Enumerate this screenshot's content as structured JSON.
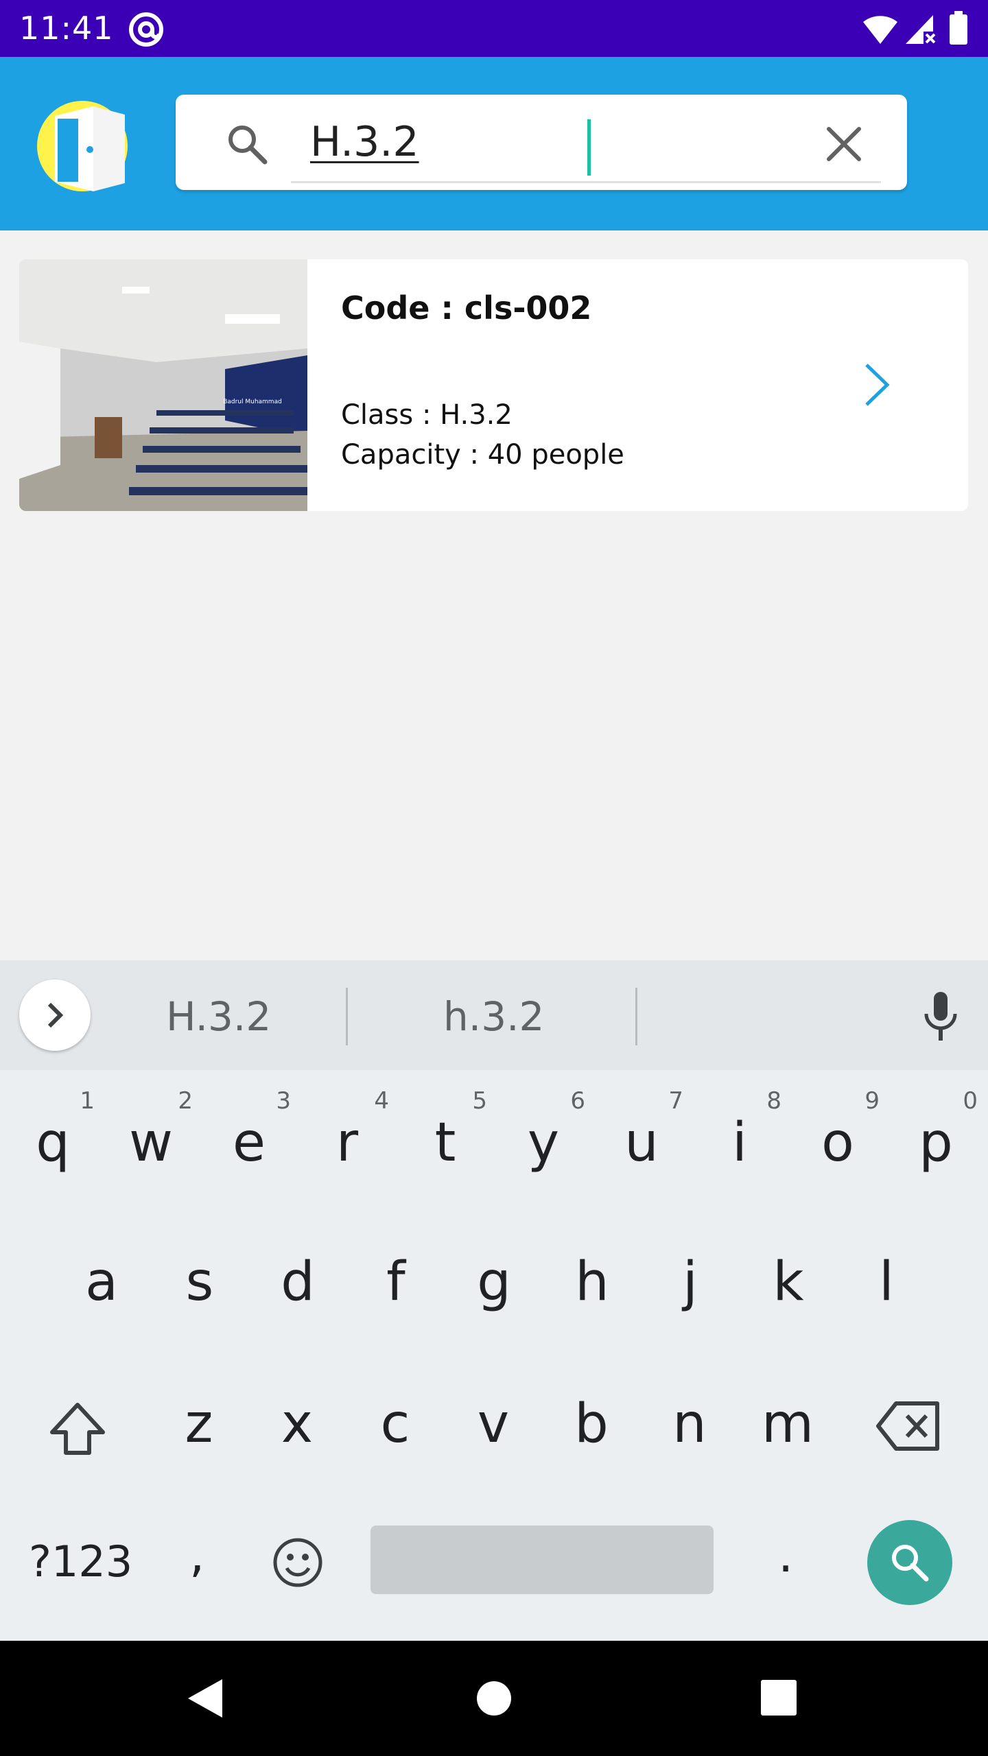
{
  "status_bar": {
    "time": "11:41"
  },
  "search": {
    "value": "H.3.2"
  },
  "results": [
    {
      "code": "Code : cls-002",
      "class": "Class : H.3.2",
      "capacity": "Capacity : 40 people",
      "photo_caption": "Badrul Muhammad"
    }
  ],
  "keyboard": {
    "suggestions": [
      "H.3.2",
      "h.3.2"
    ],
    "row1": [
      {
        "key": "q",
        "hint": "1"
      },
      {
        "key": "w",
        "hint": "2"
      },
      {
        "key": "e",
        "hint": "3"
      },
      {
        "key": "r",
        "hint": "4"
      },
      {
        "key": "t",
        "hint": "5"
      },
      {
        "key": "y",
        "hint": "6"
      },
      {
        "key": "u",
        "hint": "7"
      },
      {
        "key": "i",
        "hint": "8"
      },
      {
        "key": "o",
        "hint": "9"
      },
      {
        "key": "p",
        "hint": "0"
      }
    ],
    "row2": [
      "a",
      "s",
      "d",
      "f",
      "g",
      "h",
      "j",
      "k",
      "l"
    ],
    "row3": [
      "z",
      "x",
      "c",
      "v",
      "b",
      "n",
      "m"
    ],
    "symbols_label": "?123",
    "comma": ",",
    "period": "."
  },
  "colors": {
    "status_bar": "#3b00b5",
    "app_bar": "#1da1e2",
    "accent": "#3aa99b",
    "chevron": "#1da1e2"
  },
  "icons": [
    "at-sign-icon",
    "wifi-icon",
    "signal-icon",
    "battery-icon",
    "door-logo-icon",
    "search-icon",
    "clear-icon",
    "chevron-right-icon",
    "mic-icon",
    "shift-icon",
    "backspace-icon",
    "emoji-icon",
    "nav-back-icon",
    "nav-home-icon",
    "nav-recents-icon"
  ]
}
